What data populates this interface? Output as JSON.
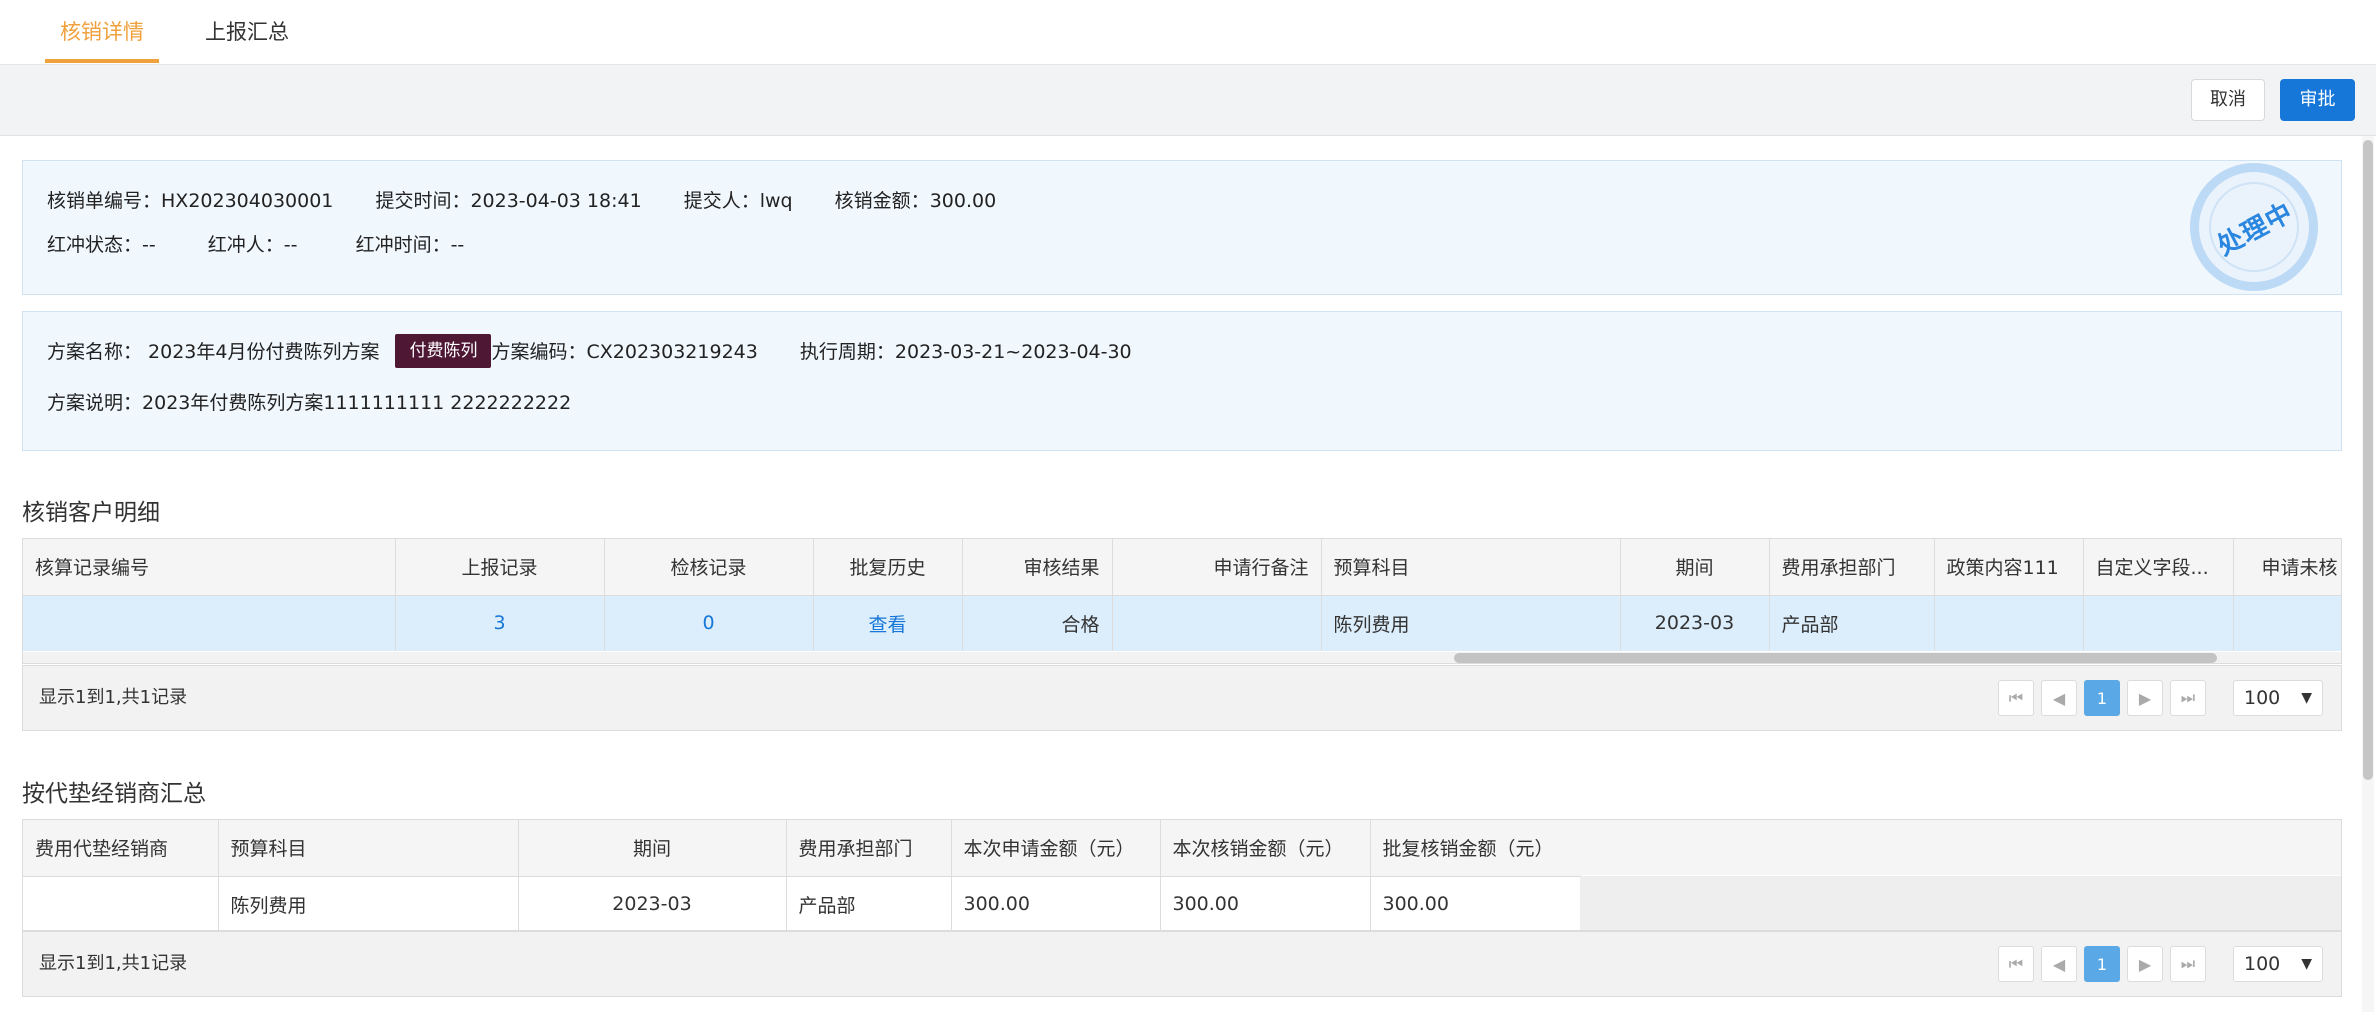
{
  "tabs": [
    {
      "label": "核销详情",
      "active": true
    },
    {
      "label": "上报汇总",
      "active": false
    }
  ],
  "toolbar": {
    "cancel_label": "取消",
    "approve_label": "审批"
  },
  "summary": {
    "order_no_label": "核销单编号：",
    "order_no": "HX202304030001",
    "submit_time_label": "提交时间：",
    "submit_time": "2023-04-03 18:41",
    "submitter_label": "提交人：",
    "submitter": "lwq",
    "amount_label": "核销金额：",
    "amount": "300.00",
    "red_status_label": "红冲状态：",
    "red_status": "--",
    "red_person_label": "红冲人：",
    "red_person": "--",
    "red_time_label": "红冲时间：",
    "red_time": "--",
    "stamp": "处理中"
  },
  "plan": {
    "name_label": "方案名称：",
    "name": "2023年4月份付费陈列方案",
    "tag": "付费陈列",
    "code_label": "方案编码：",
    "code": "CX202303219243",
    "period_label": "执行周期：",
    "period": "2023-03-21~2023-04-30",
    "desc_label": "方案说明：",
    "desc": "2023年付费陈列方案1111111111 2222222222"
  },
  "customer_detail": {
    "title": "核销客户明细",
    "columns": [
      "核算记录编号",
      "上报记录",
      "检核记录",
      "批复历史",
      "审核结果",
      "申请行备注",
      "预算科目",
      "期间",
      "费用承担部门",
      "政策内容111",
      "自定义字段...",
      "申请未核"
    ],
    "rows": [
      {
        "record_no": "",
        "report": "3",
        "check": "0",
        "history": "查看",
        "result": "合格",
        "remark": "",
        "budget": "陈列费用",
        "period": "2023-03",
        "dept": "产品部",
        "policy": "",
        "custom": "",
        "unverified": ""
      }
    ],
    "footer_text": "显示1到1,共1记录",
    "page_current": "1",
    "page_size": "100"
  },
  "dealer_summary": {
    "title": "按代垫经销商汇总",
    "columns": [
      "费用代垫经销商",
      "预算科目",
      "期间",
      "费用承担部门",
      "本次申请金额（元）",
      "本次核销金额（元）",
      "批复核销金额（元）"
    ],
    "rows": [
      {
        "dealer": "",
        "budget": "陈列费用",
        "period": "2023-03",
        "dept": "产品部",
        "apply": "300.00",
        "verify": "300.00",
        "approved": "300.00"
      }
    ],
    "footer_text": "显示1到1,共1记录",
    "page_current": "1",
    "page_size": "100"
  },
  "icons": {
    "first": "first-page-icon",
    "prev": "prev-page-icon",
    "next": "next-page-icon",
    "last": "last-page-icon",
    "dropdown": "chevron-down-icon"
  },
  "colors": {
    "accent_tab": "#f0a03c",
    "primary": "#1677d8",
    "tag_bg": "#4e1835",
    "stamp": "#2b86e0"
  }
}
